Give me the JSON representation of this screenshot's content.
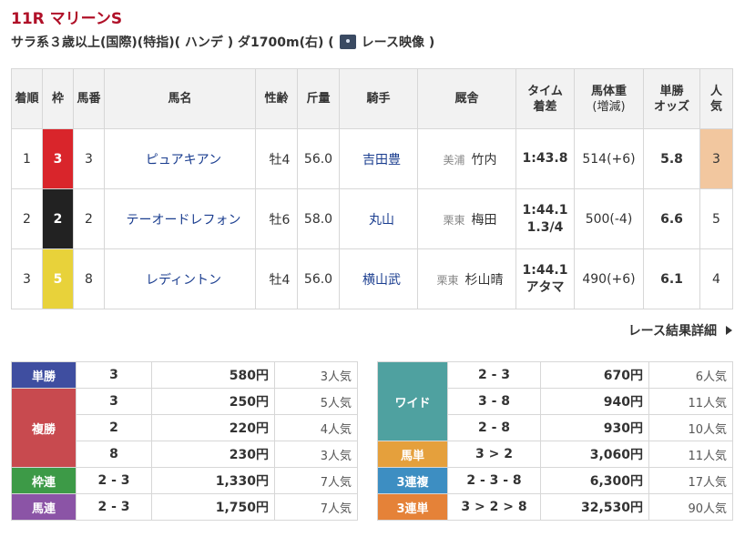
{
  "race": {
    "title": "11R マリーンS",
    "conditions": "サラ系３歳以上(国際)(特指)( ハンデ ) ダ1700m(右)  (",
    "video_label": "レース映像 )"
  },
  "results_table": {
    "headers": {
      "rank": "着順",
      "waku": "枠",
      "umaban": "馬番",
      "horse": "馬名",
      "sexage": "性齢",
      "weight": "斤量",
      "jockey": "騎手",
      "trainer": "厩舎",
      "time_top": "タイム",
      "time_bottom": "着差",
      "body_top": "馬体重",
      "body_bottom": "(増減)",
      "odds_top": "単勝",
      "odds_bottom": "オッズ",
      "pop_top": "人",
      "pop_bottom": "気"
    },
    "rows": [
      {
        "rank": "1",
        "waku": "3",
        "umaban": "3",
        "horse": "ピュアキアン",
        "sexage": "牡4",
        "weight": "56.0",
        "jockey": "吉田豊",
        "affiliation": "美浦",
        "trainer": "竹内",
        "time": "1:43.8",
        "margin": "",
        "body": "514(+6)",
        "odds": "5.8",
        "pop": "3"
      },
      {
        "rank": "2",
        "waku": "2",
        "umaban": "2",
        "horse": "テーオードレフォン",
        "sexage": "牡6",
        "weight": "58.0",
        "jockey": "丸山",
        "affiliation": "栗東",
        "trainer": "梅田",
        "time": "1:44.1",
        "margin": "1.3/4",
        "body": "500(-4)",
        "odds": "6.6",
        "pop": "5"
      },
      {
        "rank": "3",
        "waku": "5",
        "umaban": "8",
        "horse": "レディントン",
        "sexage": "牡4",
        "weight": "56.0",
        "jockey": "横山武",
        "affiliation": "栗東",
        "trainer": "杉山晴",
        "time": "1:44.1",
        "margin": "アタマ",
        "body": "490(+6)",
        "odds": "6.1",
        "pop": "4"
      }
    ]
  },
  "detail_link": "レース結果詳細",
  "payouts_left": {
    "tansho": {
      "label": "単勝",
      "rows": [
        {
          "combo": "3",
          "amount": "580円",
          "pop": "3人気"
        }
      ]
    },
    "fukusho": {
      "label": "複勝",
      "rows": [
        {
          "combo": "3",
          "amount": "250円",
          "pop": "5人気"
        },
        {
          "combo": "2",
          "amount": "220円",
          "pop": "4人気"
        },
        {
          "combo": "8",
          "amount": "230円",
          "pop": "3人気"
        }
      ]
    },
    "wakuren": {
      "label": "枠連",
      "rows": [
        {
          "combo": "2 - 3",
          "amount": "1,330円",
          "pop": "7人気"
        }
      ]
    },
    "umaren": {
      "label": "馬連",
      "rows": [
        {
          "combo": "2 - 3",
          "amount": "1,750円",
          "pop": "7人気"
        }
      ]
    }
  },
  "payouts_right": {
    "wide": {
      "label": "ワイド",
      "rows": [
        {
          "combo": "2 - 3",
          "amount": "670円",
          "pop": "6人気"
        },
        {
          "combo": "3 - 8",
          "amount": "940円",
          "pop": "11人気"
        },
        {
          "combo": "2 - 8",
          "amount": "930円",
          "pop": "10人気"
        }
      ]
    },
    "umatan": {
      "label": "馬単",
      "rows": [
        {
          "combo": "3 > 2",
          "amount": "3,060円",
          "pop": "11人気"
        }
      ]
    },
    "sanfuku": {
      "label": "3連複",
      "rows": [
        {
          "combo": "2 - 3 - 8",
          "amount": "6,300円",
          "pop": "17人気"
        }
      ]
    },
    "santan": {
      "label": "3連単",
      "rows": [
        {
          "combo": "3 > 2 > 8",
          "amount": "32,530円",
          "pop": "90人気"
        }
      ]
    }
  },
  "colors": {
    "title": "#b01028",
    "waku3": "#d9252b",
    "waku2": "#222222",
    "waku5": "#e8d23a",
    "tansho": "#3f4ea0",
    "fukusho": "#c84a4f",
    "wakuren": "#3d9a47",
    "umaren": "#8b54a6",
    "wide": "#4fa1a0",
    "umatan": "#e5a03c",
    "sanfuku": "#3d8ec2",
    "santan": "#e58238",
    "popular_highlight": "#f2c79f"
  }
}
